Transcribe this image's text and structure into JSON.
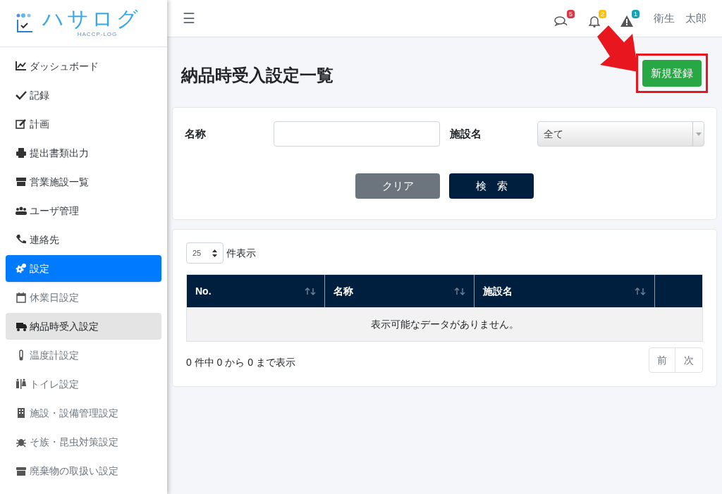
{
  "logo": {
    "title": "ハサログ",
    "subtitle": "HACCP-LOG"
  },
  "sidebar": {
    "items": [
      {
        "label": "ダッシュボード",
        "kind": "main",
        "selected": false
      },
      {
        "label": "記録",
        "kind": "main",
        "selected": false
      },
      {
        "label": "計画",
        "kind": "main",
        "selected": false
      },
      {
        "label": "提出書類出力",
        "kind": "main",
        "selected": false
      },
      {
        "label": "営業施設一覧",
        "kind": "main",
        "selected": false
      },
      {
        "label": "ユーザ管理",
        "kind": "main",
        "selected": false
      },
      {
        "label": "連絡先",
        "kind": "main",
        "selected": false
      },
      {
        "label": "設定",
        "kind": "main",
        "selected": true
      },
      {
        "label": "休業日設定",
        "kind": "sub",
        "selected": false
      },
      {
        "label": "納品時受入設定",
        "kind": "sub",
        "selected": true
      },
      {
        "label": "温度計設定",
        "kind": "sub",
        "selected": false
      },
      {
        "label": "トイレ設定",
        "kind": "sub",
        "selected": false
      },
      {
        "label": "施設・設備管理設定",
        "kind": "sub",
        "selected": false
      },
      {
        "label": "そ族・昆虫対策設定",
        "kind": "sub",
        "selected": false
      },
      {
        "label": "廃棄物の取扱い設定",
        "kind": "sub",
        "selected": false
      }
    ]
  },
  "header": {
    "menu_glyph": "☰",
    "badges": [
      {
        "kind": "messages",
        "count": "5",
        "color": "#dc3545"
      },
      {
        "kind": "notifications",
        "count": "2",
        "color": "#ffc107"
      },
      {
        "kind": "alerts",
        "count": "1",
        "color": "#17a2b8"
      }
    ],
    "user": "衛生　太郎"
  },
  "page": {
    "title": "納品時受入設定一覧",
    "new_button": "新規登録"
  },
  "search": {
    "name_label": "名称",
    "facility_label": "施設名",
    "facility_value": "全て",
    "clear_button": "クリア",
    "search_button": "検　索"
  },
  "table": {
    "page_size": "25",
    "page_size_label": "件表示",
    "columns": [
      "No.",
      "名称",
      "施設名"
    ],
    "empty_message": "表示可能なデータがありません。",
    "info": "0 件中 0 から 0 まで表示",
    "prev": "前",
    "next": "次"
  }
}
